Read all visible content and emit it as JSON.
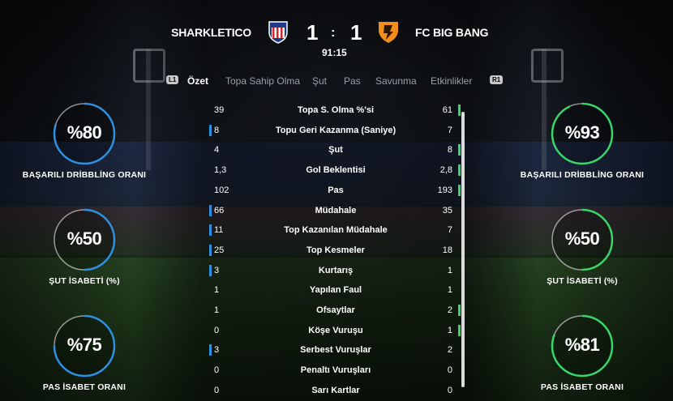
{
  "match": {
    "home_team": "SHARKLETICO",
    "away_team": "FC BIG BANG",
    "home_score": "1",
    "separator": ":",
    "away_score": "1",
    "clock": "91:15"
  },
  "tabs": {
    "left_hint": "L1",
    "right_hint": "R1",
    "items": [
      "Özet",
      "Topa Sahip Olma",
      "Şut",
      "Pas",
      "Savunma",
      "Etkinlikler"
    ],
    "active": "Özet"
  },
  "stats": [
    {
      "label": "Topa S. Olma %'si",
      "home": "39",
      "away": "61",
      "leader": "away"
    },
    {
      "label": "Topu Geri Kazanma (Saniye)",
      "home": "8",
      "away": "7",
      "leader": "home"
    },
    {
      "label": "Şut",
      "home": "4",
      "away": "8",
      "leader": "away"
    },
    {
      "label": "Gol Beklentisi",
      "home": "1,3",
      "away": "2,8",
      "leader": "away"
    },
    {
      "label": "Pas",
      "home": "102",
      "away": "193",
      "leader": "away"
    },
    {
      "label": "Müdahale",
      "home": "66",
      "away": "35",
      "leader": "home"
    },
    {
      "label": "Top Kazanılan Müdahale",
      "home": "11",
      "away": "7",
      "leader": "home"
    },
    {
      "label": "Top Kesmeler",
      "home": "25",
      "away": "18",
      "leader": "home"
    },
    {
      "label": "Kurtarış",
      "home": "3",
      "away": "1",
      "leader": "home"
    },
    {
      "label": "Yapılan Faul",
      "home": "1",
      "away": "1",
      "leader": "none"
    },
    {
      "label": "Ofsaytlar",
      "home": "1",
      "away": "2",
      "leader": "away"
    },
    {
      "label": "Köşe Vuruşu",
      "home": "0",
      "away": "1",
      "leader": "away"
    },
    {
      "label": "Serbest Vuruşlar",
      "home": "3",
      "away": "2",
      "leader": "home"
    },
    {
      "label": "Penaltı Vuruşları",
      "home": "0",
      "away": "0",
      "leader": "none"
    },
    {
      "label": "Sarı Kartlar",
      "home": "0",
      "away": "0",
      "leader": "none"
    }
  ],
  "gauges": {
    "home": [
      {
        "value": "%80",
        "fraction": 0.8,
        "label": "BAŞARILI DRİBBLİNG ORANI"
      },
      {
        "value": "%50",
        "fraction": 0.5,
        "label": "ŞUT İSABETİ (%)"
      },
      {
        "value": "%75",
        "fraction": 0.75,
        "label": "PAS İSABET ORANI"
      }
    ],
    "away": [
      {
        "value": "%93",
        "fraction": 0.93,
        "label": "BAŞARILI DRİBBLİNG ORANI"
      },
      {
        "value": "%50",
        "fraction": 0.5,
        "label": "ŞUT İSABETİ (%)"
      },
      {
        "value": "%81",
        "fraction": 0.81,
        "label": "PAS İSABET ORANI"
      }
    ]
  },
  "colors": {
    "home_accent": "#2f8fe0",
    "away_accent": "#39d66a",
    "home_crest": "atletico-style-crest",
    "away_crest": "orange-rocket-crest"
  }
}
